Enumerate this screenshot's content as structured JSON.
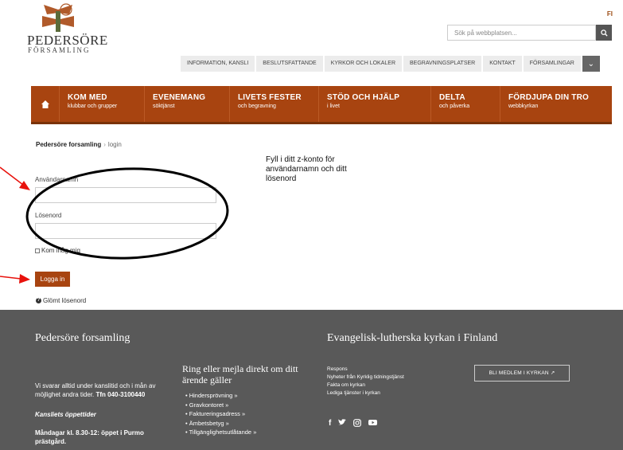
{
  "header": {
    "logo_name": "PEDERSÖRE",
    "logo_sub": "FÖRSAMLING",
    "lang": "FI",
    "search_placeholder": "Sök på webbplatsen...",
    "top_nav": [
      "INFORMATION, KANSLI",
      "BESLUTSFATTANDE",
      "KYRKOR OCH LOKALER",
      "BEGRAVNINGSPLATSER",
      "KONTAKT",
      "FÖRSAMLINGAR"
    ]
  },
  "main_nav": [
    {
      "title": "KOM MED",
      "sub": "klubbar och grupper"
    },
    {
      "title": "EVENEMANG",
      "sub": "söktjänst"
    },
    {
      "title": "LIVETS FESTER",
      "sub": "och begravning"
    },
    {
      "title": "STÖD OCH HJÄLP",
      "sub": "i livet"
    },
    {
      "title": "DELTA",
      "sub": "och påverka"
    },
    {
      "title": "FÖRDJUPA DIN TRO",
      "sub": "webbkyrkan"
    }
  ],
  "breadcrumb": {
    "home": "Pedersöre forsamling",
    "sep": "›",
    "current": "login"
  },
  "form": {
    "username_label": "Användarnamn",
    "password_label": "Lösenord",
    "remember_label": "Kom ihåg mig",
    "login_button": "Logga in",
    "forgot_label": "Glömt lösenord"
  },
  "annotation": "Fyll i ditt z-konto för användarnamn och ditt lösenord",
  "footer": {
    "title_left": "Pedersöre forsamling",
    "title_right": "Evangelisk-lutherska kyrkan i Finland",
    "hours_text": "Vi svarar alltid under kanslitid och i mån av möjlighet andra tider.",
    "phone": "Tfn 040-3100440",
    "office_hours_title": "Kansliets öppettider",
    "office_hours": "Måndagar kl. 8.30-12: öppet i Purmo prästgård.",
    "ring_title": "Ring eller mejla direkt om ditt ärende gäller",
    "ring_list": [
      "Hindersprövning »",
      "Gravkontoret »",
      "Faktureringsadress »",
      "Ämbetsbetyg »",
      "Tillgänglighetsutlåtande »"
    ],
    "links": [
      "Respons",
      "Nyheter från Kyrklig tidningstjänst",
      "Fakta om kyrkan",
      "Lediga tjänster i kyrkan"
    ],
    "member_button": "BLI MEDLEM I KYRKAN ↗",
    "social_icons": [
      "facebook-icon",
      "twitter-icon",
      "instagram-icon",
      "youtube-icon"
    ]
  },
  "colors": {
    "brand": "#a84410",
    "footer": "#595959",
    "annotation": "#e8120c"
  }
}
